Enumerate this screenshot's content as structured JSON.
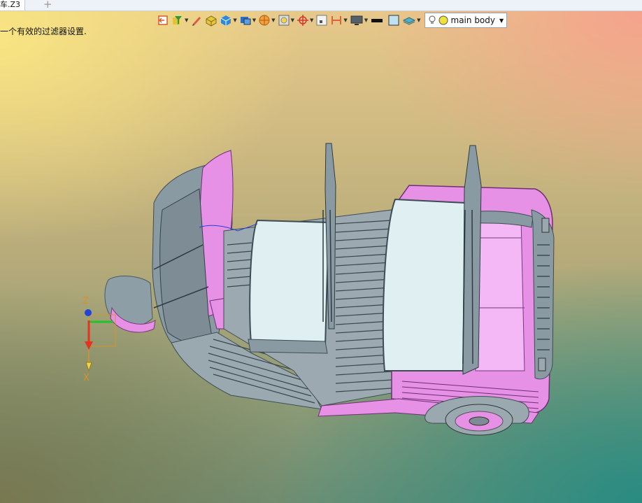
{
  "tab": {
    "title": "车.Z3",
    "add_symbol": "+"
  },
  "status": {
    "message": "一个有效的过滤器设置."
  },
  "toolbar": {
    "buttons": [
      {
        "icon": "exit-sketch-icon",
        "dropdown": false
      },
      {
        "icon": "filter-icon",
        "dropdown": true
      },
      {
        "icon": "pen-icon",
        "dropdown": false
      },
      {
        "icon": "shaded-box-icon",
        "dropdown": false
      },
      {
        "icon": "render-mode-icon",
        "dropdown": true
      },
      {
        "icon": "view-cube-icon",
        "dropdown": true
      },
      {
        "icon": "section-view-icon",
        "dropdown": true
      },
      {
        "icon": "zoom-fit-icon",
        "dropdown": true
      },
      {
        "icon": "origin-icon",
        "dropdown": true
      },
      {
        "icon": "grid-icon",
        "dropdown": false
      },
      {
        "icon": "align-icon",
        "dropdown": true
      },
      {
        "icon": "display-icon",
        "dropdown": true
      },
      {
        "icon": "line-style-icon",
        "dropdown": false
      },
      {
        "icon": "color-swatch-icon",
        "dropdown": false
      },
      {
        "icon": "layer-icon",
        "dropdown": true
      }
    ],
    "part_selector": {
      "value": "main body"
    }
  },
  "axis": {
    "z_label": "Z",
    "x_label": "X"
  },
  "colors": {
    "body_gray": "#8a9aa3",
    "pink": "#e690e6",
    "light_pink": "#f3b8f5",
    "seat_light": "#dfeff2",
    "axis_green": "#22c22a",
    "axis_red": "#e53322",
    "axis_blue": "#2343d8",
    "axis_orange": "#d8922c"
  }
}
